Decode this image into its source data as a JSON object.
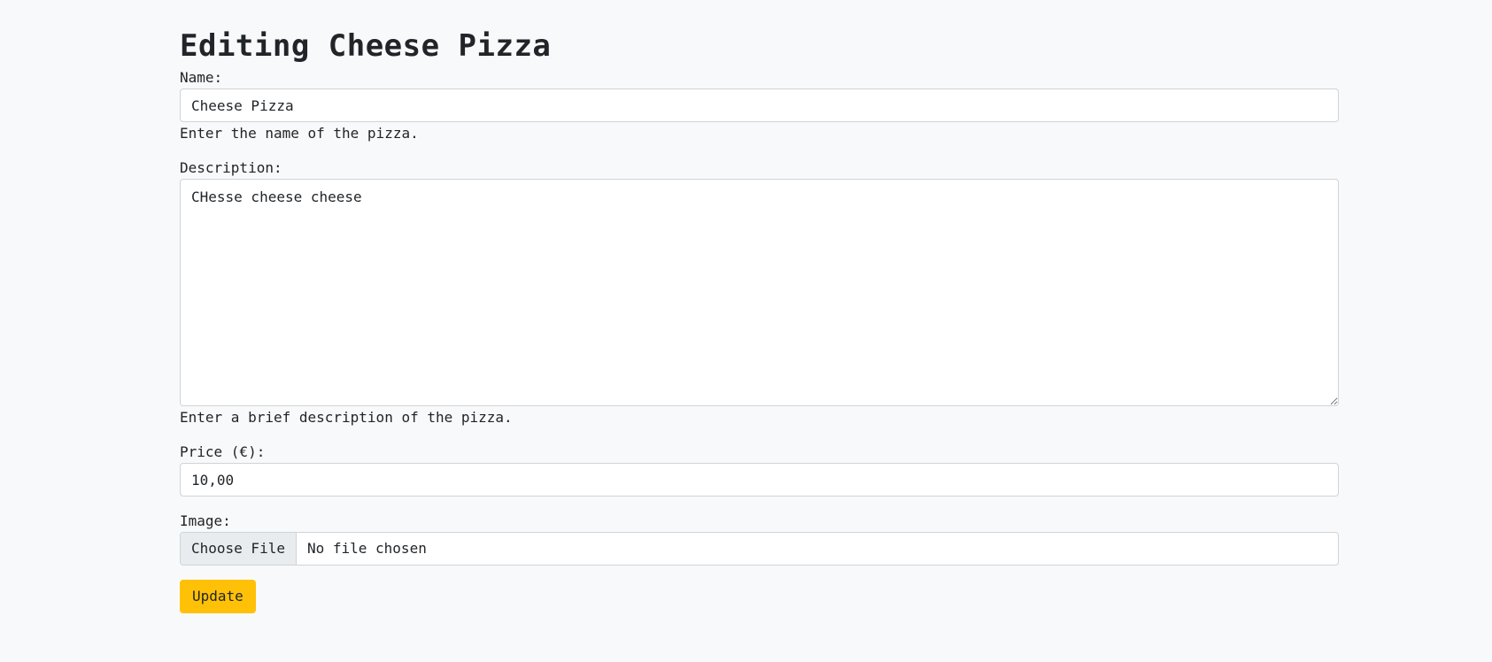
{
  "page": {
    "title": "Editing Cheese Pizza"
  },
  "form": {
    "name": {
      "label": "Name:",
      "value": "Cheese Pizza",
      "help": "Enter the name of the pizza."
    },
    "description": {
      "label": "Description:",
      "value": "CHesse cheese cheese",
      "help": "Enter a brief description of the pizza."
    },
    "price": {
      "label": "Price (€):",
      "value": "10,00"
    },
    "image": {
      "label": "Image:",
      "button_label": "Choose File",
      "status": "No file chosen"
    },
    "submit_label": "Update"
  },
  "colors": {
    "background": "#f8f9fa",
    "input_border": "#ced4da",
    "file_button_bg": "#e9ecef",
    "update_button": "#ffc107",
    "text": "#212529"
  }
}
